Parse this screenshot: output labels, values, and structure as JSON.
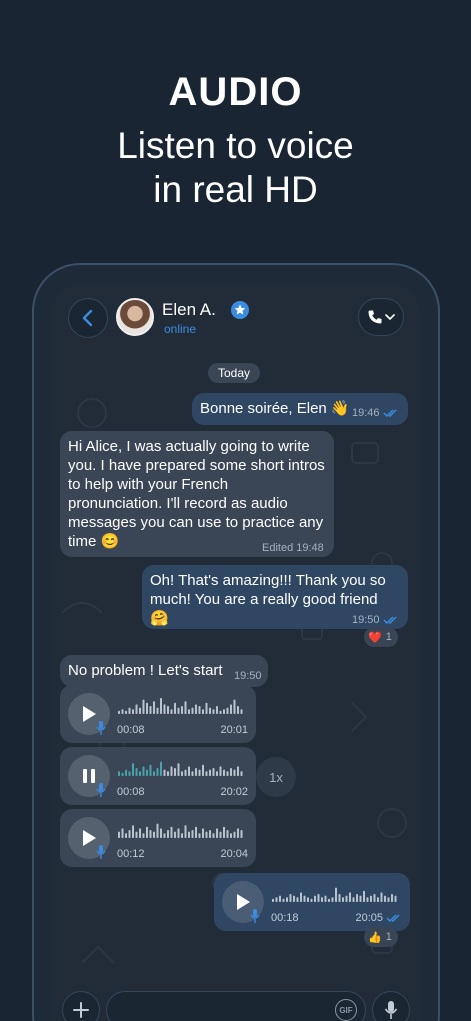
{
  "promo": {
    "heading": "AUDIO",
    "subtitle_line1": "Listen to voice",
    "subtitle_line2": "in real HD"
  },
  "header": {
    "contact_name": "Elen A.",
    "status": "online",
    "icons": [
      "back-arrow-icon",
      "avatar",
      "verified-star-icon",
      "phone-icon",
      "chevron-down-icon"
    ]
  },
  "chat": {
    "date_label": "Today",
    "messages": [
      {
        "direction": "out",
        "text": "Bonne soirée, Elen 👋",
        "time": "19:46",
        "read": true
      },
      {
        "direction": "in",
        "lines": [
          "Hi Alice, I was actually going to write",
          "you. I have prepared some short intros",
          "to help with your French",
          "pronunciation. I'll record as audio",
          "messages you can use to practice any",
          "time 😊"
        ],
        "meta": "Edited 19:48"
      },
      {
        "direction": "out",
        "lines": [
          "Oh! That's amazing!!! Thank you so",
          "much! You are a really good friend 🤗"
        ],
        "time": "19:50",
        "read": true,
        "reaction": {
          "emoji": "❤️",
          "count": "1"
        }
      },
      {
        "direction": "in",
        "text": "No problem ! Let's start",
        "time": "19:50"
      }
    ],
    "voice_messages": [
      {
        "direction": "in",
        "duration": "00:08",
        "time": "20:01",
        "state": "paused-play"
      },
      {
        "direction": "in",
        "duration": "00:08",
        "time": "20:02",
        "state": "playing",
        "speed": "1x"
      },
      {
        "direction": "in",
        "duration": "00:12",
        "time": "20:04",
        "state": "paused-play"
      },
      {
        "direction": "out",
        "duration": "00:18",
        "time": "20:05",
        "state": "paused-play",
        "read": true,
        "reaction": {
          "emoji": "👍",
          "count": "1"
        }
      }
    ]
  },
  "composer": {
    "placeholder": "",
    "gif_label": "GIF"
  },
  "colors": {
    "background": "#1a2533",
    "incoming_bubble": "#3a4656",
    "outgoing_bubble": "#2f4763",
    "accent": "#3b8be0"
  }
}
